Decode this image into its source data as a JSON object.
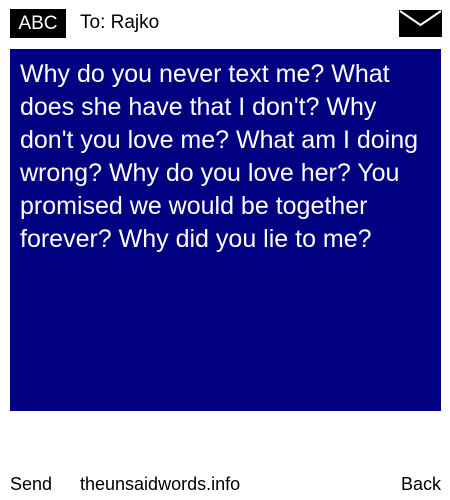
{
  "header": {
    "input_mode": "ABC",
    "recipient": "To: Rajko",
    "icon": "envelope-icon"
  },
  "message": {
    "body": "Why do you never text me? What does she have that I don't? Why don't you love me? What am I doing wrong? Why do you love her? You promised we would be together forever? Why did you lie to me?"
  },
  "footer": {
    "left_softkey": "Send",
    "center_text": "theunsaidwords.info",
    "right_softkey": "Back"
  },
  "colors": {
    "message_background": "#000080",
    "message_text": "#ffffff",
    "badge_background": "#000000",
    "page_background": "#ffffff"
  }
}
